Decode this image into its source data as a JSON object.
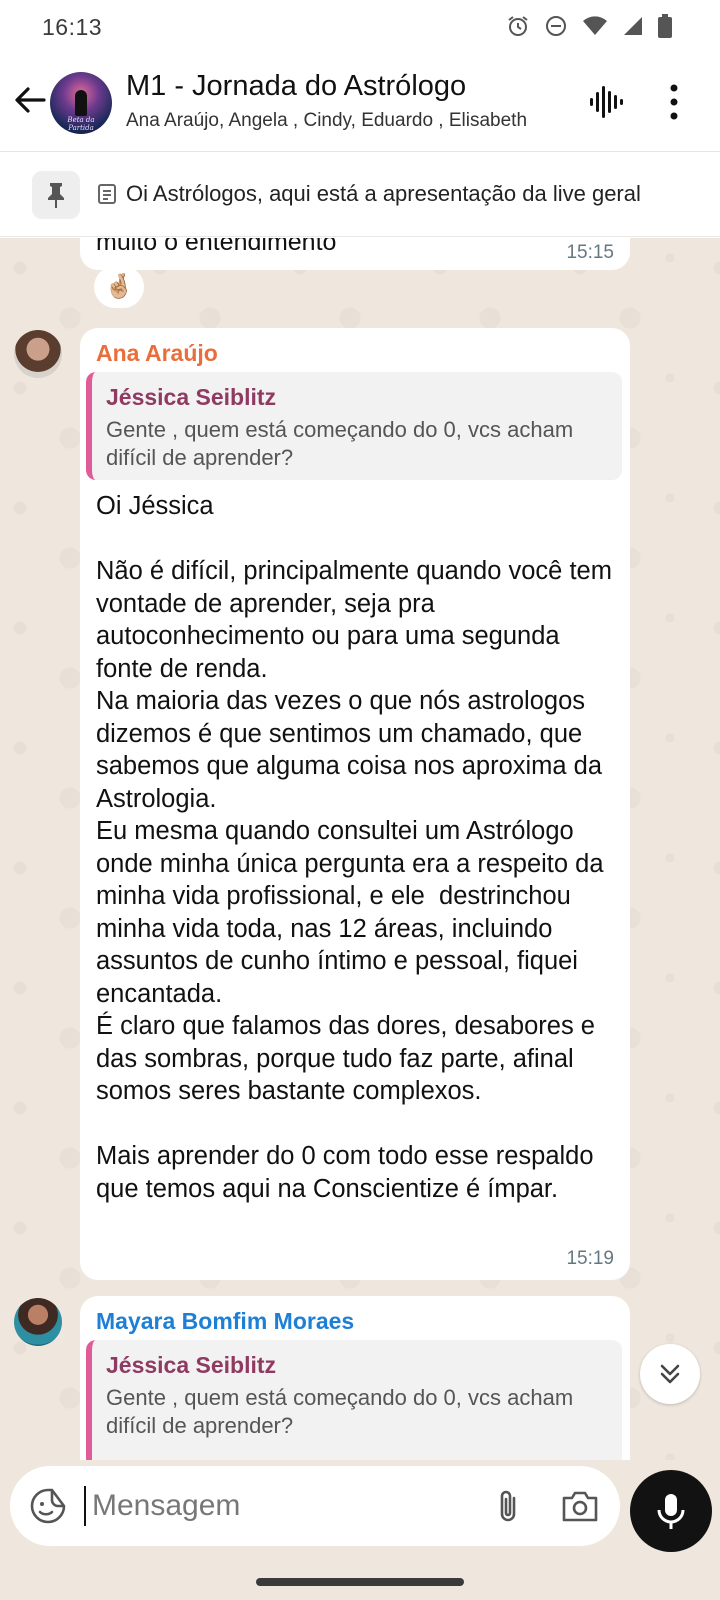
{
  "status_bar": {
    "time": "16:13",
    "icons": [
      "alarm-icon",
      "do-not-disturb-icon",
      "wifi-icon",
      "signal-icon",
      "battery-icon"
    ]
  },
  "header": {
    "title": "M1 - Jornada do Astrólogo",
    "members": "Ana Araújo, Angela , Cindy, Eduardo , Elisabeth",
    "avatar_caption": "Beta da Partida"
  },
  "pinned": {
    "text": "Oi Astrólogos, aqui está a apresentação da live geral"
  },
  "messages": [
    {
      "text": "muito o entendimento",
      "time": "15:15",
      "reaction": "🤞🏼"
    },
    {
      "sender": "Ana Araújo",
      "quote": {
        "sender": "Jéssica Seiblitz",
        "text": "Gente , quem está começando do 0, vcs acham difícil de aprender?"
      },
      "text": "Oi Jéssica\n\nNão é difícil, principalmente quando você tem vontade de aprender, seja pra autoconhecimento ou para uma segunda fonte de renda.\nNa maioria das vezes o que nós astrologos dizemos é que sentimos um chamado, que sabemos que alguma coisa nos aproxima da Astrologia.\nEu mesma quando consultei um Astrólogo onde minha única pergunta era a respeito da minha vida profissional, e ele  destrinchou minha vida toda, nas 12 áreas, incluindo assuntos de cunho íntimo e pessoal, fiquei encantada.\nÉ claro que falamos das dores, desabores e das sombras, porque tudo faz parte, afinal somos seres bastante complexos.\n\nMais aprender do 0 com todo esse respaldo que temos aqui na Conscientize é ímpar.",
      "time": "15:19"
    },
    {
      "sender": "Mayara Bomfim Moraes",
      "quote": {
        "sender": "Jéssica Seiblitz",
        "text": "Gente , quem está começando do 0, vcs acham difícil de aprender?"
      }
    }
  ],
  "input": {
    "placeholder": "Mensagem",
    "value": ""
  },
  "colors": {
    "chat_background": "#efe7dd",
    "sender_ana": "#e96e3a",
    "sender_mayara": "#1d7fd6",
    "quote_accent": "#e05c98",
    "quote_sender": "#8f3a62"
  }
}
